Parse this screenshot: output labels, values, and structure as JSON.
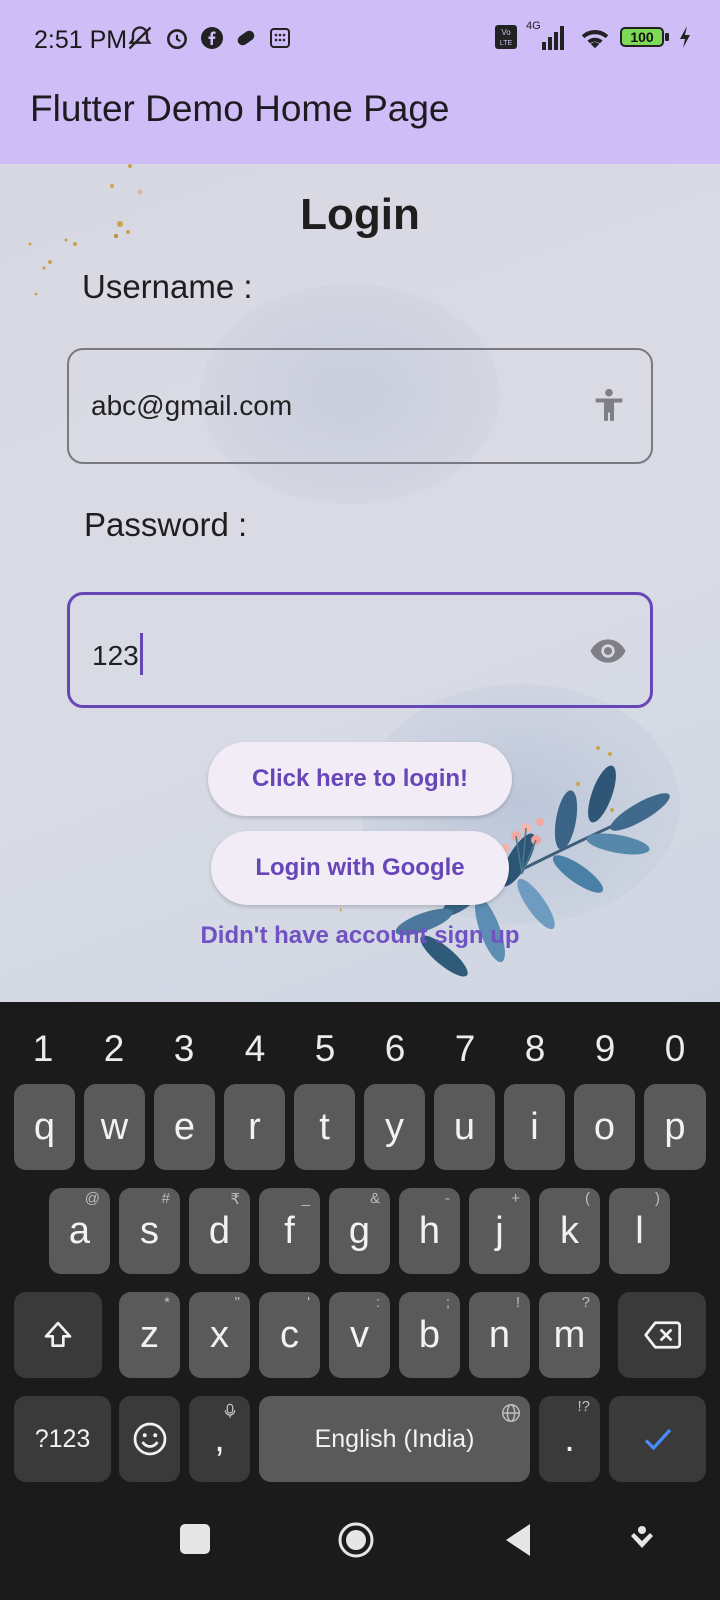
{
  "status_bar": {
    "time": "2:51 PM",
    "left_icons": [
      "mute-icon",
      "alarm-icon",
      "facebook-icon",
      "game-icon",
      "calculator-icon"
    ],
    "network": "4G",
    "battery": "100",
    "right_icons": [
      "volte-icon",
      "signal-icon",
      "wifi-icon",
      "battery-icon",
      "charging-icon"
    ]
  },
  "app_bar": {
    "title": "Flutter Demo Home Page"
  },
  "login": {
    "title": "Login",
    "username_label": "Username :",
    "username_value": "abc@gmail.com",
    "password_label": "Password :",
    "password_value": "123",
    "login_button": "Click here to login!",
    "google_button": "Login with Google",
    "signup_link": "Didn't have account sign up"
  },
  "keyboard": {
    "numbers": [
      "1",
      "2",
      "3",
      "4",
      "5",
      "6",
      "7",
      "8",
      "9",
      "0"
    ],
    "row1": [
      "q",
      "w",
      "e",
      "r",
      "t",
      "y",
      "u",
      "i",
      "o",
      "p"
    ],
    "row2": [
      {
        "k": "a",
        "h": "@"
      },
      {
        "k": "s",
        "h": "#"
      },
      {
        "k": "d",
        "h": "₹"
      },
      {
        "k": "f",
        "h": "_"
      },
      {
        "k": "g",
        "h": "&"
      },
      {
        "k": "h",
        "h": "-"
      },
      {
        "k": "j",
        "h": "+"
      },
      {
        "k": "k",
        "h": "("
      },
      {
        "k": "l",
        "h": ")"
      }
    ],
    "row3": [
      {
        "k": "z",
        "h": "*"
      },
      {
        "k": "x",
        "h": "\""
      },
      {
        "k": "c",
        "h": "'"
      },
      {
        "k": "v",
        "h": ":"
      },
      {
        "k": "b",
        "h": ";"
      },
      {
        "k": "n",
        "h": "!"
      },
      {
        "k": "m",
        "h": "?"
      }
    ],
    "symbols_key": "?123",
    "comma": ",",
    "space_label": "English (India)",
    "period": ".",
    "period_hint": "!?"
  },
  "colors": {
    "app_bar": "#cfbdf7",
    "accent": "#6746b8",
    "keyboard_bg": "#1b1b1b",
    "key": "#5a5a5a"
  }
}
